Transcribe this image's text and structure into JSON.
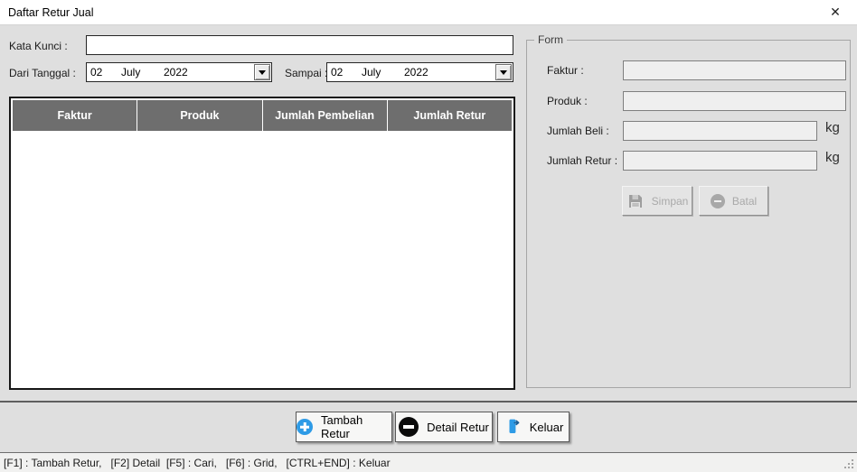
{
  "window": {
    "title": "Daftar Retur Jual"
  },
  "filters": {
    "keyword_label": "Kata Kunci :",
    "keyword_value": "",
    "from_label": "Dari Tanggal :",
    "from_date": {
      "day": "02",
      "month": "July",
      "year": "2022"
    },
    "to_label": "Sampai :",
    "to_date": {
      "day": "02",
      "month": "July",
      "year": "2022"
    }
  },
  "table": {
    "columns": [
      "Faktur",
      "Produk",
      "Jumlah Pembelian",
      "Jumlah Retur"
    ],
    "rows": []
  },
  "form": {
    "legend": "Form",
    "faktur_label": "Faktur :",
    "faktur_value": "",
    "produk_label": "Produk :",
    "produk_value": "",
    "jumlah_beli_label": "Jumlah Beli :",
    "jumlah_beli_value": "",
    "jumlah_beli_unit": "kg",
    "jumlah_retur_label": "Jumlah Retur :",
    "jumlah_retur_value": "",
    "jumlah_retur_unit": "kg",
    "save_label": "Simpan",
    "cancel_label": "Batal",
    "save_enabled": false,
    "cancel_enabled": false
  },
  "actions": {
    "add_label": "Tambah Retur",
    "detail_label": "Detail Retur",
    "exit_label": "Keluar"
  },
  "statusbar": {
    "text": "[F1] : Tambah Retur,   [F2] Detail  [F5] : Cari,   [F6] : Grid,   [CTRL+END] : Keluar"
  },
  "colors": {
    "accent_blue": "#2e9be6",
    "table_header_bg": "#6e6e6e",
    "detail_icon_black": "#0a0a0a",
    "disabled_gray": "#a9a9a9"
  }
}
